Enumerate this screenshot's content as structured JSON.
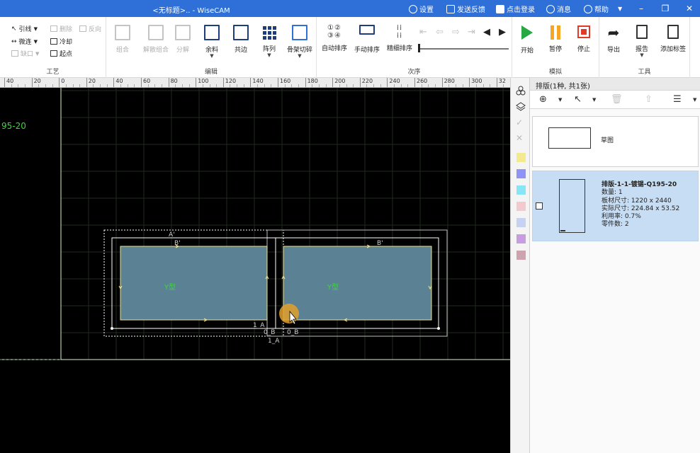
{
  "titlebar": {
    "title": "<无标题>.. - WiseCAM",
    "settings": "设置",
    "feedback": "发送反馈",
    "login": "点击登录",
    "messages": "消息",
    "help": "帮助"
  },
  "ribbon": {
    "craft": {
      "label": "工艺",
      "lead": "引线",
      "microconnect": "微连",
      "notch": "缺口",
      "delete": "删除",
      "cooling": "冷却",
      "reverse": "反向",
      "start_point": "起点"
    },
    "edit": {
      "label": "编辑",
      "combine": "组合",
      "uncombine": "解散组合",
      "explode": "分解",
      "remnant": "余料",
      "common_edge": "共边",
      "array": "阵列",
      "skeleton_cut": "骨架切碎"
    },
    "order": {
      "label": "次序",
      "auto_sort": "自动排序",
      "manual_sort": "手动排序",
      "fine_sort": "精细排序",
      "slider_value": 0
    },
    "simulate": {
      "label": "模拟",
      "start": "开始",
      "pause": "暂停",
      "stop": "停止"
    },
    "tools": {
      "label": "工具",
      "export": "导出",
      "report": "报告",
      "add_tag": "添加标签"
    }
  },
  "ruler": {
    "ticks": [
      "40",
      "20",
      "0",
      "20",
      "40",
      "60",
      "80",
      "100",
      "120",
      "140",
      "160",
      "180",
      "200",
      "220",
      "240",
      "260",
      "280",
      "300",
      "32"
    ]
  },
  "canvas": {
    "left_label": "95-20",
    "part_label_left": "Y型",
    "part_label_right": "Y型",
    "annotations": {
      "a_top": "A'",
      "b_left": "B'",
      "b_right": "B'",
      "one_a_mid": "1_A",
      "zero_b_left": "0_B",
      "one_a_bottom": "1_A",
      "zero_b_right": "0_B"
    }
  },
  "panel": {
    "header": "排版(1种, 共1张)",
    "sketch_label": "草图",
    "nest": {
      "title": "排版-1-1-镀锡-Q195-20",
      "count": "数量: 1",
      "sheet_size": "板材尺寸: 1220 x 2440",
      "actual_size": "实际尺寸: 224.84 x 53.52",
      "utilization": "利用率: 0.7%",
      "part_count": "零件数: 2"
    }
  },
  "layer_colors": [
    "#f3e98f",
    "#8f93f5",
    "#86e6f3",
    "#f3c9cf",
    "#c7d1f1",
    "#c89ce0",
    "#cfa3ad"
  ],
  "colors": {
    "titlebar": "#2e6fd8",
    "part_fill": "#5b8294",
    "selection": "#c7ddf3",
    "green_text": "#3ed43e"
  }
}
